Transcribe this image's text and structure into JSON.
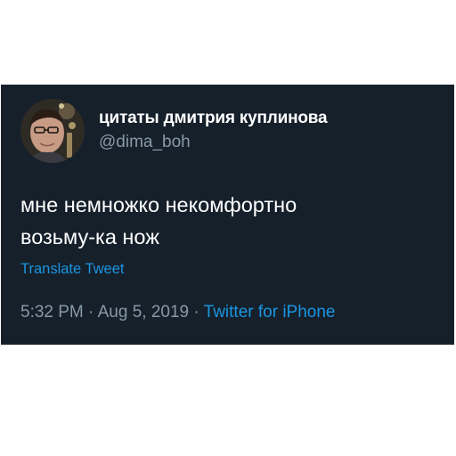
{
  "tweet": {
    "author": {
      "display_name": "цитаты дмитрия куплинова",
      "handle": "@dima_boh"
    },
    "text_lines": [
      "мне немножко некомфортно",
      "возьму-ка нож"
    ],
    "translate_label": "Translate Tweet",
    "time": "5:32 PM",
    "separator": "·",
    "date": "Aug 5, 2019",
    "source": "Twitter for iPhone"
  },
  "colors": {
    "background": "#15202b",
    "primary_text": "#ffffff",
    "secondary_text": "#8899a6",
    "link": "#1b95e0"
  }
}
